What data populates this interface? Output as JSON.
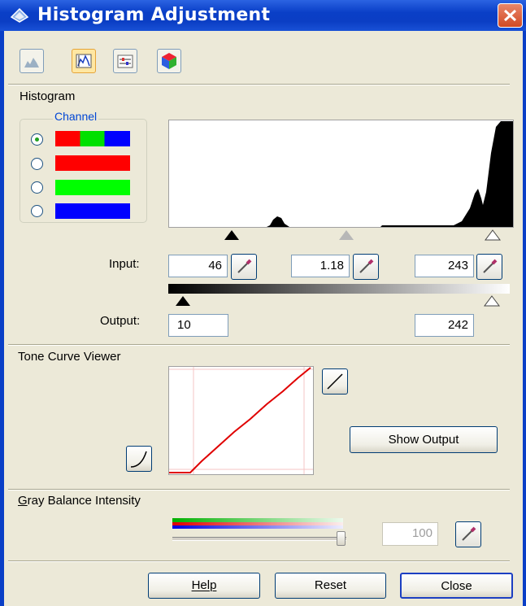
{
  "window": {
    "title": "Histogram Adjustment",
    "close_glyph": "×"
  },
  "toolbar": {
    "buttons": [
      "histogram-view",
      "histogram-adjust",
      "tone-correction",
      "color-palette"
    ],
    "selected": 1
  },
  "histogram": {
    "section_label": "Histogram",
    "channel_label": "Channel",
    "channels": [
      "RGB",
      "Red",
      "Green",
      "Blue"
    ],
    "selected_channel": 0,
    "input_label": "Input:",
    "input_low": "46",
    "input_gamma": "1.18",
    "input_high": "243",
    "output_label": "Output:",
    "output_low": "10",
    "output_high": "242"
  },
  "tone_curve": {
    "section_label": "Tone Curve Viewer",
    "show_output_label": "Show Output"
  },
  "gray_balance": {
    "section_label": "Gray Balance Intensity",
    "value": "100"
  },
  "footer": {
    "help": "Help",
    "reset": "Reset",
    "close": "Close"
  }
}
